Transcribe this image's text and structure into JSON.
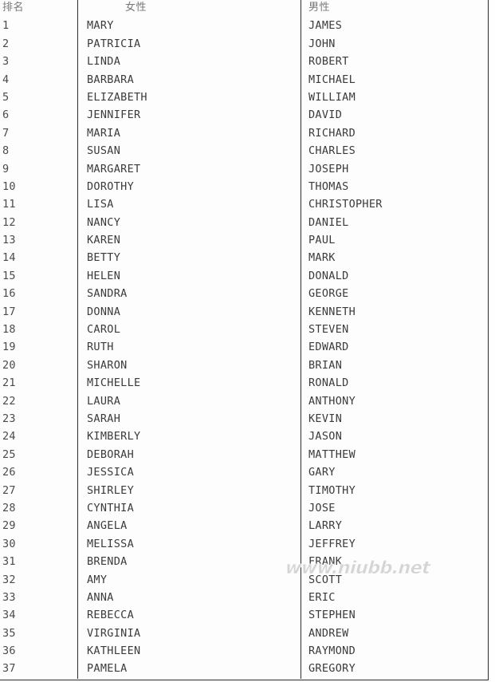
{
  "table": {
    "headers": {
      "rank": "排名",
      "female": "女性",
      "male": "男性"
    },
    "rows": [
      {
        "rank": "1",
        "female": "MARY",
        "male": "JAMES"
      },
      {
        "rank": "2",
        "female": "PATRICIA",
        "male": "JOHN"
      },
      {
        "rank": "3",
        "female": "LINDA",
        "male": "ROBERT"
      },
      {
        "rank": "4",
        "female": "BARBARA",
        "male": "MICHAEL"
      },
      {
        "rank": "5",
        "female": "ELIZABETH",
        "male": "WILLIAM"
      },
      {
        "rank": "6",
        "female": "JENNIFER",
        "male": "DAVID"
      },
      {
        "rank": "7",
        "female": "MARIA",
        "male": "RICHARD"
      },
      {
        "rank": "8",
        "female": "SUSAN",
        "male": "CHARLES"
      },
      {
        "rank": "9",
        "female": "MARGARET",
        "male": "JOSEPH"
      },
      {
        "rank": "10",
        "female": "DOROTHY",
        "male": "THOMAS"
      },
      {
        "rank": "11",
        "female": "LISA",
        "male": "CHRISTOPHER"
      },
      {
        "rank": "12",
        "female": "NANCY",
        "male": "DANIEL"
      },
      {
        "rank": "13",
        "female": "KAREN",
        "male": "PAUL"
      },
      {
        "rank": "14",
        "female": "BETTY",
        "male": "MARK"
      },
      {
        "rank": "15",
        "female": "HELEN",
        "male": "DONALD"
      },
      {
        "rank": "16",
        "female": "SANDRA",
        "male": "GEORGE"
      },
      {
        "rank": "17",
        "female": "DONNA",
        "male": "KENNETH"
      },
      {
        "rank": "18",
        "female": "CAROL",
        "male": "STEVEN"
      },
      {
        "rank": "19",
        "female": "RUTH",
        "male": "EDWARD"
      },
      {
        "rank": "20",
        "female": "SHARON",
        "male": "BRIAN"
      },
      {
        "rank": "21",
        "female": "MICHELLE",
        "male": "RONALD"
      },
      {
        "rank": "22",
        "female": "LAURA",
        "male": "ANTHONY"
      },
      {
        "rank": "23",
        "female": "SARAH",
        "male": "KEVIN"
      },
      {
        "rank": "24",
        "female": "KIMBERLY",
        "male": "JASON"
      },
      {
        "rank": "25",
        "female": "DEBORAH",
        "male": "MATTHEW"
      },
      {
        "rank": "26",
        "female": "JESSICA",
        "male": "GARY"
      },
      {
        "rank": "27",
        "female": "SHIRLEY",
        "male": "TIMOTHY"
      },
      {
        "rank": "28",
        "female": "CYNTHIA",
        "male": "JOSE"
      },
      {
        "rank": "29",
        "female": "ANGELA",
        "male": "LARRY"
      },
      {
        "rank": "30",
        "female": "MELISSA",
        "male": "JEFFREY"
      },
      {
        "rank": "31",
        "female": "BRENDA",
        "male": "FRANK"
      },
      {
        "rank": "32",
        "female": "AMY",
        "male": "SCOTT"
      },
      {
        "rank": "33",
        "female": "ANNA",
        "male": "ERIC"
      },
      {
        "rank": "34",
        "female": "REBECCA",
        "male": "STEPHEN"
      },
      {
        "rank": "35",
        "female": "VIRGINIA",
        "male": "ANDREW"
      },
      {
        "rank": "36",
        "female": "KATHLEEN",
        "male": "RAYMOND"
      },
      {
        "rank": "37",
        "female": "PAMELA",
        "male": "GREGORY"
      }
    ]
  },
  "watermark": {
    "text": "www.niubb.net"
  },
  "colors": {
    "border": "#2b2b2b",
    "text": "#3b3b3b",
    "header_text": "#787878",
    "rank_text": "#4a4a4a",
    "watermark": "#d2d2d2",
    "background": "#fdfdfd"
  }
}
